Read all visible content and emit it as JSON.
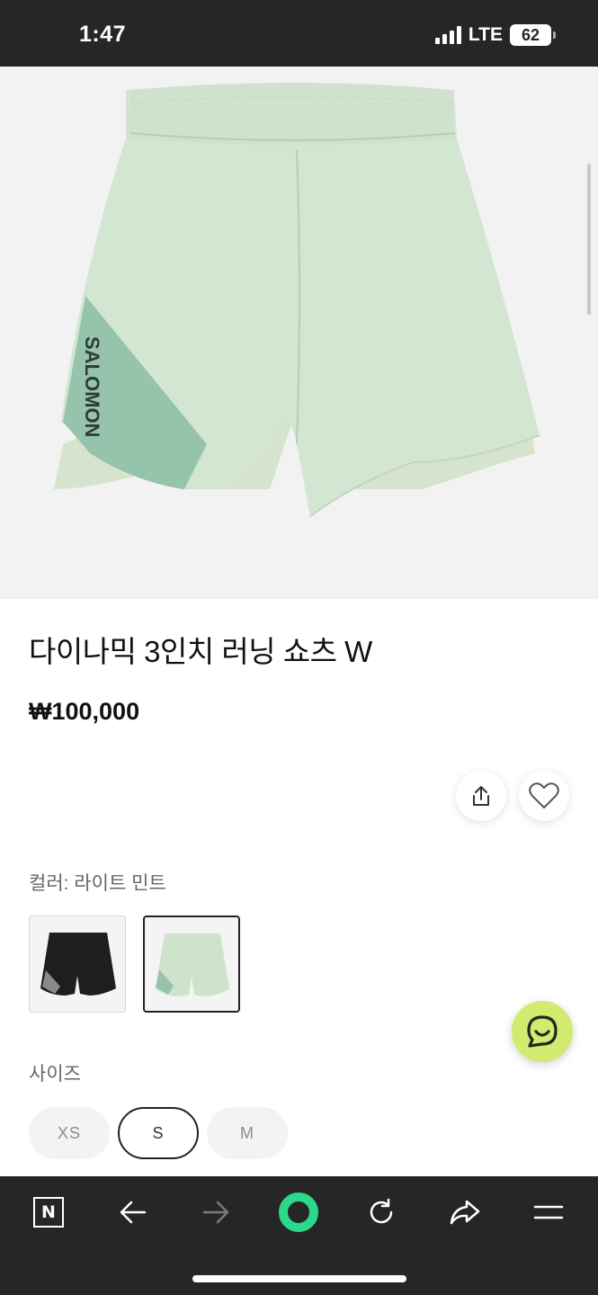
{
  "status_bar": {
    "time": "1:47",
    "network": "LTE",
    "battery": "62"
  },
  "product": {
    "image_icon": "mint-running-shorts-image",
    "name": "다이나믹 3인치 러닝 쇼츠 W",
    "price": "₩100,000",
    "brand_print": "SALOMON"
  },
  "actions": {
    "share_icon": "share-icon",
    "like_icon": "heart-icon"
  },
  "color": {
    "label": "컬러: 라이트 민트",
    "options": [
      {
        "name": "black",
        "selected": false,
        "color": "#1e1e1e"
      },
      {
        "name": "light-mint",
        "selected": true,
        "color": "#cfe3cc"
      }
    ]
  },
  "size": {
    "label": "사이즈",
    "options": [
      {
        "label": "XS",
        "selected": false
      },
      {
        "label": "S",
        "selected": true
      },
      {
        "label": "M",
        "selected": false
      }
    ]
  },
  "chat_button": {
    "icon": "chat-icon",
    "color": "#d2ea6e"
  },
  "bottom_nav": {
    "items": [
      "n-logo-icon",
      "back-arrow-icon",
      "forward-arrow-icon",
      "home-ring-icon",
      "reload-icon",
      "share-arrow-icon",
      "menu-icon"
    ],
    "logo_letter": "N",
    "accent": "#2bd98a"
  }
}
